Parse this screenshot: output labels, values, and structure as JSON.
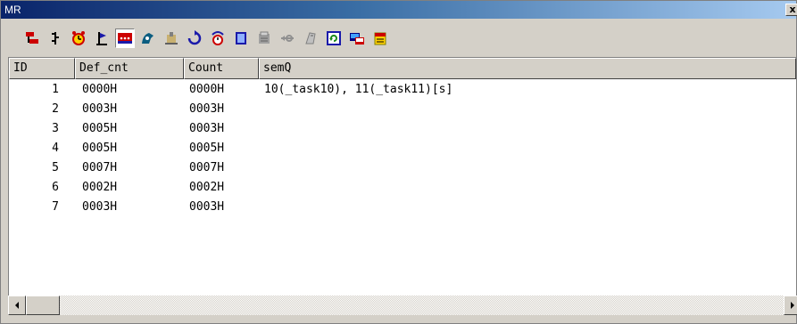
{
  "window": {
    "title": "MR",
    "close_label": "x"
  },
  "toolbar": {
    "buttons": [
      {
        "icon": "task-tree-icon"
      },
      {
        "icon": "ready-queue-icon"
      },
      {
        "icon": "timer-icon"
      },
      {
        "icon": "event-flag-icon"
      },
      {
        "icon": "semaphore-icon",
        "active": true
      },
      {
        "icon": "mailbox-icon"
      },
      {
        "icon": "data-queue-icon"
      },
      {
        "icon": "cyclic-handler-icon"
      },
      {
        "icon": "alarm-handler-icon"
      },
      {
        "icon": "memory-pool-icon"
      },
      {
        "icon": "fixed-memory-pool-icon"
      },
      {
        "icon": "port-icon"
      },
      {
        "icon": "rendezvous-icon"
      },
      {
        "icon": "refresh-icon"
      },
      {
        "icon": "system-status-icon"
      },
      {
        "icon": "calendar-icon"
      }
    ]
  },
  "table": {
    "columns": [
      "ID",
      "Def_cnt",
      "Count",
      "semQ"
    ],
    "rows": [
      {
        "id": "1",
        "def_cnt": "0000H",
        "count": "0000H",
        "semq": "10(_task10), 11(_task11)[s]"
      },
      {
        "id": "2",
        "def_cnt": "0003H",
        "count": "0003H",
        "semq": ""
      },
      {
        "id": "3",
        "def_cnt": "0005H",
        "count": "0003H",
        "semq": ""
      },
      {
        "id": "4",
        "def_cnt": "0005H",
        "count": "0005H",
        "semq": ""
      },
      {
        "id": "5",
        "def_cnt": "0007H",
        "count": "0007H",
        "semq": ""
      },
      {
        "id": "6",
        "def_cnt": "0002H",
        "count": "0002H",
        "semq": ""
      },
      {
        "id": "7",
        "def_cnt": "0003H",
        "count": "0003H",
        "semq": ""
      }
    ]
  },
  "colors": {
    "title_start": "#0a246a",
    "title_end": "#a6caf0",
    "face": "#d4d0c8"
  }
}
